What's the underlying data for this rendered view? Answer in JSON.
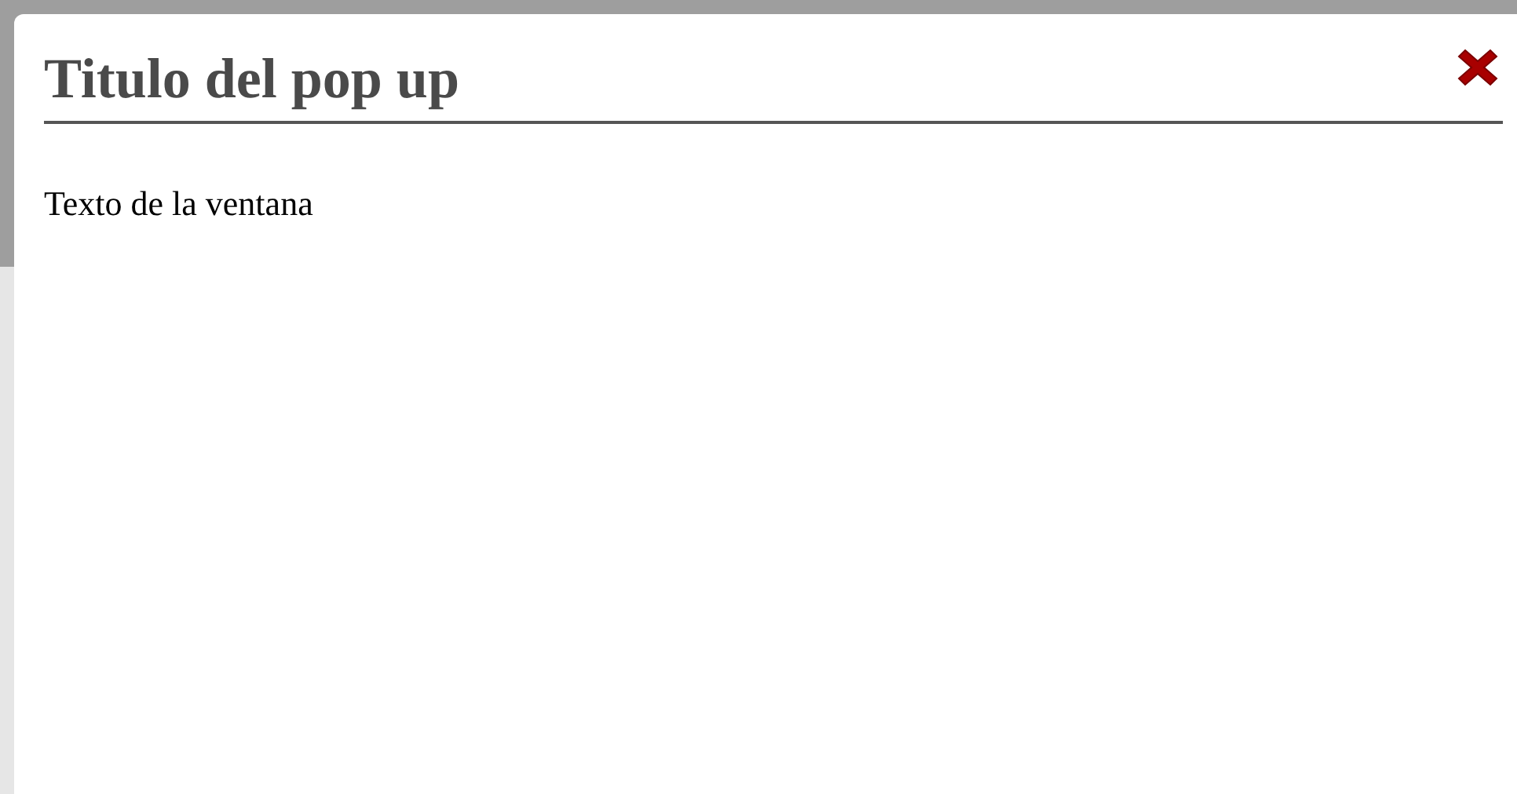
{
  "popup": {
    "title": "Titulo del pop up",
    "body": "Texto de la ventana",
    "closable": true
  }
}
